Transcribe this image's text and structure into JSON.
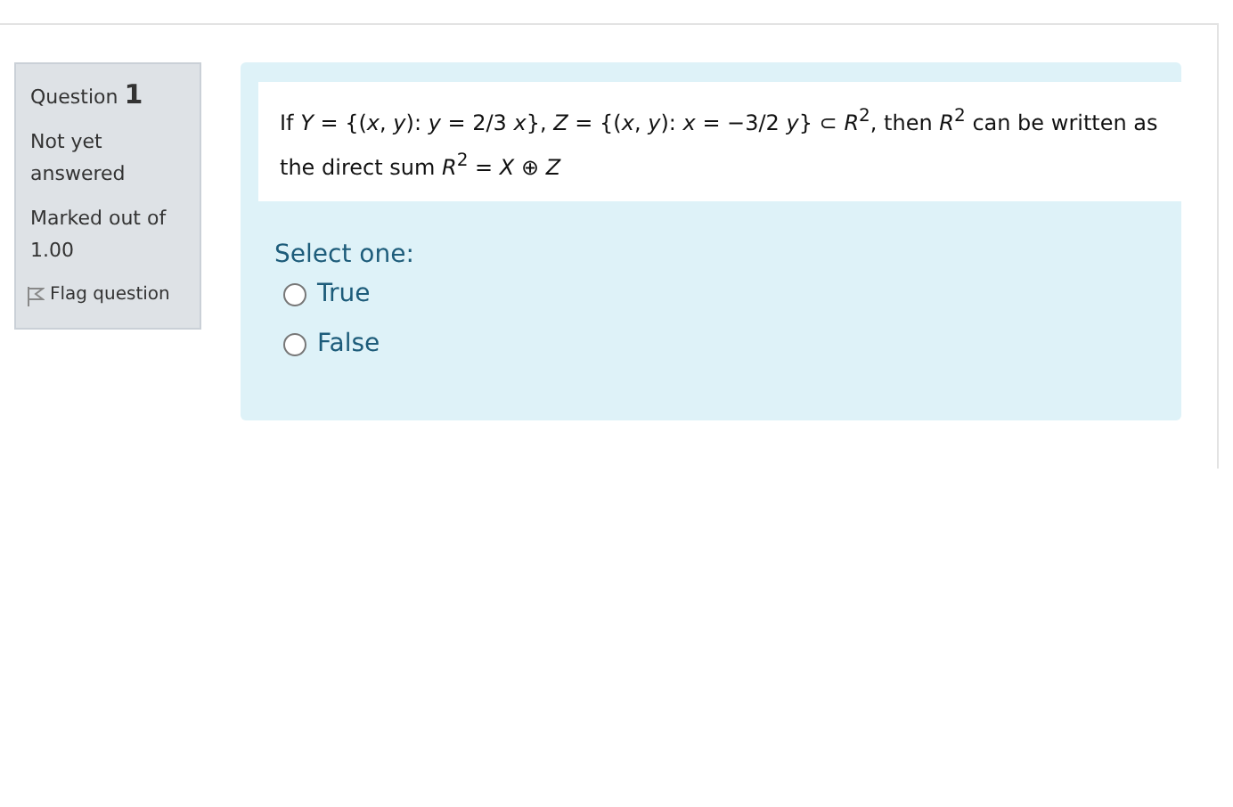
{
  "info": {
    "label": "Question",
    "number": "1",
    "status": "Not yet answered",
    "marks": "Marked out of 1.00",
    "flag": "Flag question"
  },
  "question": {
    "text": "If *Y* = {(*x*, *y*): *y* = 2/3 *x*}, *Z* = {(*x*, *y*): *x* = −3/2 *y*} ⊂ *R*$^{2}$,  then *R*$^{2}$ can be written as the direct sum *R*$^{2}$ = *X* ⊕ *Z*",
    "prompt": "Select one:",
    "options": [
      {
        "label": "True",
        "selected": false
      },
      {
        "label": "False",
        "selected": false
      }
    ]
  }
}
